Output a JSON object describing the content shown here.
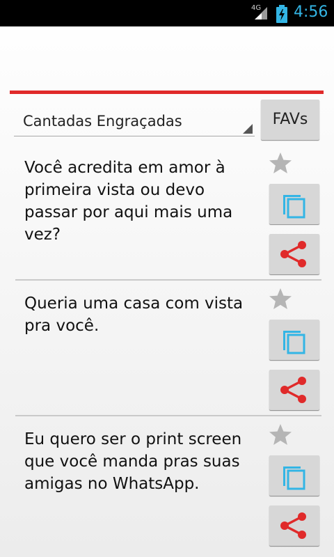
{
  "status_bar": {
    "network": "4G",
    "time": "4:56",
    "icons": [
      "signal-icon",
      "battery-charging-icon"
    ]
  },
  "accent_color": "#e02a2a",
  "spinner": {
    "selected": "Cantadas Engraçadas"
  },
  "fav_button": {
    "label": "FAVs"
  },
  "items": [
    {
      "text": "Você acredita em amor à primeira vista ou devo passar por aqui mais uma vez?"
    },
    {
      "text": "Queria uma casa com vista pra você."
    },
    {
      "text": "Eu quero ser o print screen que você manda pras suas amigas no WhatsApp."
    }
  ],
  "icons": {
    "favorite": "star-icon",
    "copy": "copy-icon",
    "share": "share-icon"
  }
}
